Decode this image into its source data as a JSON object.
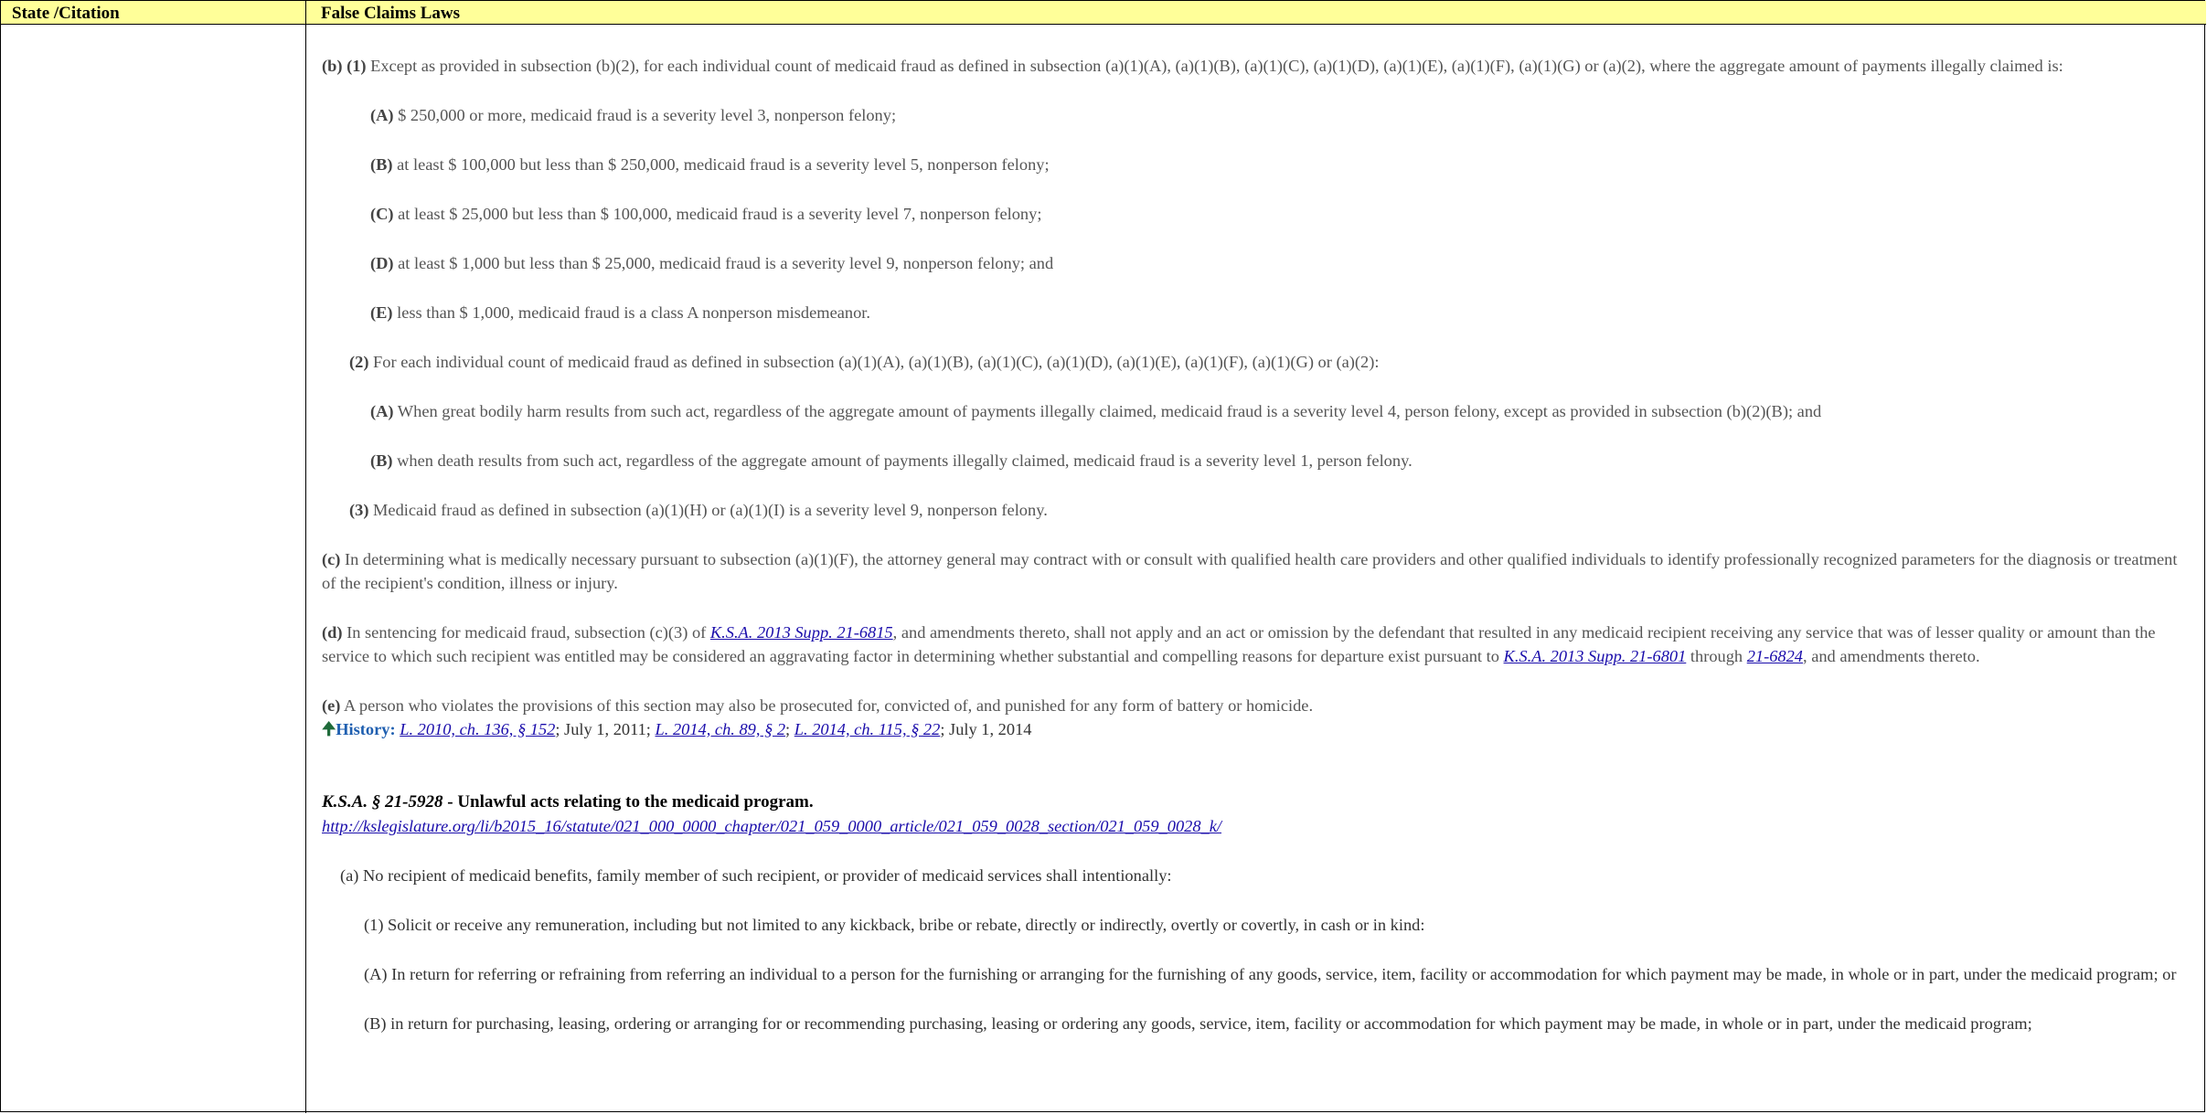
{
  "header": {
    "col1": "State /Citation",
    "col2": "False Claims Laws"
  },
  "b": {
    "label": "(b)  (1)",
    "text": " Except as provided in subsection (b)(2), for each individual count of medicaid fraud as defined in subsection (a)(1)(A), (a)(1)(B), (a)(1)(C), (a)(1)(D), (a)(1)(E), (a)(1)(F), (a)(1)(G) or (a)(2), where the aggregate amount of payments illegally claimed is:",
    "items": [
      {
        "label": "(A)",
        "text": " $ 250,000 or more, medicaid fraud is a severity level 3, nonperson felony;"
      },
      {
        "label": "(B)",
        "text": " at least $ 100,000 but less than $ 250,000, medicaid fraud is a severity level 5, nonperson felony;"
      },
      {
        "label": "(C)",
        "text": " at least $ 25,000 but less than $ 100,000, medicaid fraud is a severity level 7, nonperson felony;"
      },
      {
        "label": "(D)",
        "text": " at least $ 1,000 but less than $ 25,000, medicaid fraud is a severity level 9, nonperson felony; and"
      },
      {
        "label": "(E)",
        "text": " less than $ 1,000, medicaid fraud is a class A nonperson misdemeanor."
      }
    ],
    "two_label": "(2)",
    "two_text": " For each individual count of medicaid fraud as defined in subsection (a)(1)(A), (a)(1)(B), (a)(1)(C), (a)(1)(D), (a)(1)(E), (a)(1)(F), (a)(1)(G) or (a)(2):",
    "two_items": [
      {
        "label": "(A)",
        "text": " When great bodily harm results from such act, regardless of the aggregate amount of payments illegally claimed, medicaid fraud is a severity level 4, person felony, except as provided in subsection (b)(2)(B); and"
      },
      {
        "label": "(B)",
        "text": " when death results from such act, regardless of the aggregate amount of payments illegally claimed, medicaid fraud is a severity level 1, person felony."
      }
    ],
    "three_label": "(3)",
    "three_text": " Medicaid fraud as defined in subsection (a)(1)(H) or (a)(1)(I) is a severity level 9, nonperson felony."
  },
  "c": {
    "label": "(c)",
    "text": " In determining what is medically necessary pursuant to subsection (a)(1)(F), the attorney general may contract with or consult with qualified health care providers and other qualified individuals to identify professionally recognized parameters for the diagnosis or treatment of the recipient's condition, illness or injury."
  },
  "d": {
    "label": "(d)",
    "text1": " In sentencing for medicaid fraud, subsection (c)(3) of ",
    "link1": "K.S.A. 2013 Supp. 21-6815",
    "text2": ", and amendments thereto, shall not apply and an act or omission by the defendant that resulted in any medicaid recipient receiving any service that was of lesser quality or amount than the service to which such recipient was entitled may be considered an aggravating factor in determining whether substantial and compelling reasons for departure exist pursuant to ",
    "link2": "K.S.A. 2013 Supp. 21-6801",
    "text3": " through ",
    "link3": "21-6824",
    "text4": ", and amendments thereto."
  },
  "e": {
    "label": "(e)",
    "text": " A person who violates the provisions of this section may also be prosecuted for, convicted of, and punished for any form of battery or homicide."
  },
  "history": {
    "label": "History:",
    "link1": "L. 2010, ch. 136, § 152",
    "t1": "; July 1, 2011; ",
    "link2": "L. 2014, ch. 89, § 2",
    "t2": "; ",
    "link3": "L. 2014, ch. 115, § 22",
    "t3": "; July 1, 2014"
  },
  "section": {
    "cite": "K.S.A. § 21-5928",
    "title": " - Unlawful acts relating to the medicaid program.",
    "url": "http://kslegislature.org/li/b2015_16/statute/021_000_0000_chapter/021_059_0000_article/021_059_0028_section/021_059_0028_k/"
  },
  "sec_a": "(a) No recipient of medicaid benefits, family member of such recipient, or provider of medicaid services shall intentionally:",
  "sec_a1": "(1) Solicit or receive any remuneration, including but not limited to any kickback, bribe or rebate, directly or indirectly, overtly or covertly, in cash or in kind:",
  "sec_aA": "(A) In return for referring or refraining from referring an individual to a person for the furnishing or arranging for the furnishing of any goods, service, item, facility or accommodation for which payment may be made, in whole or in part, under the medicaid program; or",
  "sec_aB": "(B) in return for purchasing, leasing, ordering or arranging for or recommending purchasing, leasing or ordering any goods, service, item, facility or accommodation for which payment may be made, in whole or in part, under the medicaid program;"
}
